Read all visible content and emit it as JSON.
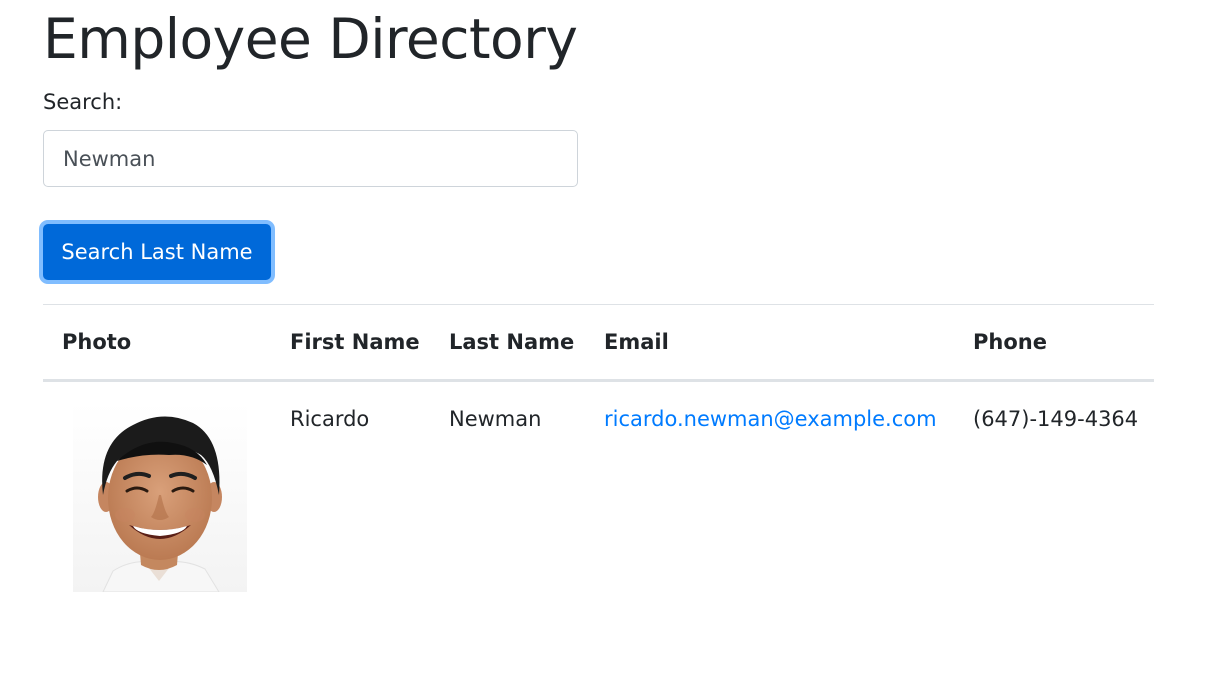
{
  "page": {
    "title": "Employee Directory"
  },
  "search": {
    "label": "Search:",
    "value": "Newman",
    "button_label": "Search Last Name"
  },
  "table": {
    "headers": {
      "photo": "Photo",
      "first_name": "First Name",
      "last_name": "Last Name",
      "email": "Email",
      "phone": "Phone"
    },
    "rows": [
      {
        "first_name": "Ricardo",
        "last_name": "Newman",
        "email": "ricardo.newman@example.com",
        "phone": "(647)-149-4364"
      }
    ]
  },
  "colors": {
    "primary": "#0069d9",
    "link": "#007bff",
    "text": "#212529",
    "border": "#dee2e6"
  }
}
